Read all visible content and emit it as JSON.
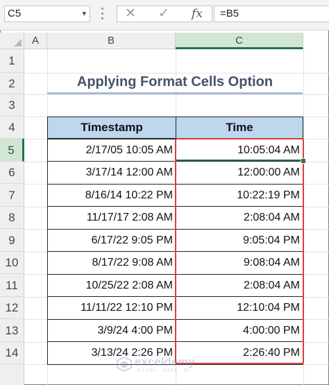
{
  "formula_bar": {
    "name_box": "C5",
    "cancel_icon": "✕",
    "enter_icon": "✓",
    "fx_label": "fx",
    "formula": "=B5"
  },
  "columns": [
    "A",
    "B",
    "C"
  ],
  "rows": [
    "1",
    "2",
    "3",
    "4",
    "5",
    "6",
    "7",
    "8",
    "9",
    "10",
    "11",
    "12",
    "13",
    "14"
  ],
  "title": "Applying Format Cells Option",
  "table": {
    "headers": [
      "Timestamp",
      "Time"
    ],
    "rows": [
      {
        "timestamp": "2/17/05 10:05 AM",
        "time": "10:05:04 AM"
      },
      {
        "timestamp": "3/17/14 12:00 AM",
        "time": "12:00:00 AM"
      },
      {
        "timestamp": "8/16/14 10:22 PM",
        "time": "10:22:19 PM"
      },
      {
        "timestamp": "11/17/17 2:08 AM",
        "time": "2:08:04 AM"
      },
      {
        "timestamp": "6/17/22 9:05 PM",
        "time": "9:05:04 PM"
      },
      {
        "timestamp": "8/17/22 9:08 AM",
        "time": "9:08:04 AM"
      },
      {
        "timestamp": "10/25/22 2:08 AM",
        "time": "2:08:04 AM"
      },
      {
        "timestamp": "11/11/22 12:10 PM",
        "time": "12:10:04 PM"
      },
      {
        "timestamp": "3/9/24 4:00 PM",
        "time": "4:00:00 PM"
      },
      {
        "timestamp": "3/13/24 2:26 PM",
        "time": "2:26:40 PM"
      }
    ]
  },
  "watermark": {
    "name": "exceldemy",
    "sub": "EXCEL · DATA · BI"
  },
  "colors": {
    "accent": "#217346",
    "highlight": "#e03a3a",
    "header_fill": "#bdd7ee"
  }
}
